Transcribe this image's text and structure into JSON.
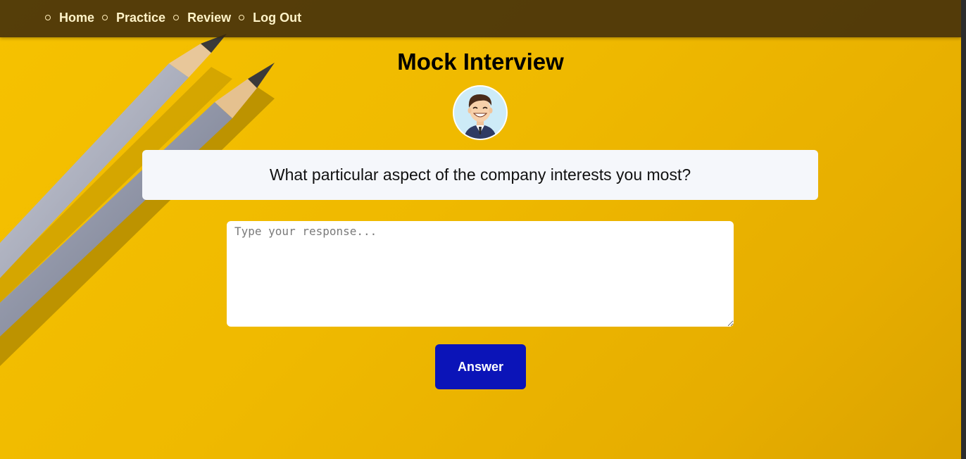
{
  "nav": {
    "items": [
      {
        "label": "Home"
      },
      {
        "label": "Practice"
      },
      {
        "label": "Review"
      },
      {
        "label": "Log Out"
      }
    ]
  },
  "page": {
    "title": "Mock Interview"
  },
  "avatar": {
    "icon": "interviewer-avatar-icon"
  },
  "question": {
    "text": "What particular aspect of the company interests you most?"
  },
  "response": {
    "value": "",
    "placeholder": "Type your response..."
  },
  "answer_button": {
    "label": "Answer"
  },
  "colors": {
    "background": "#efb900",
    "navbar": "#3a280a",
    "nav_text": "#fff3c8",
    "question_box": "#f5f7fb",
    "button": "#0b14b8",
    "button_text": "#ffffff"
  }
}
